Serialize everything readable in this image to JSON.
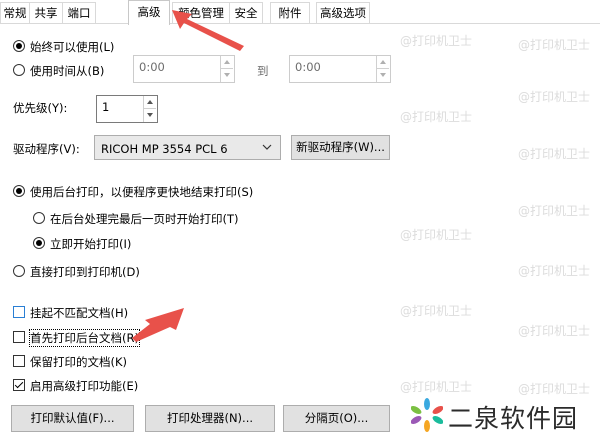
{
  "tabs": [
    "常规",
    "共享",
    "端口",
    "高级",
    "颜色管理",
    "安全",
    "附件",
    "高级选项"
  ],
  "active_tab": "高级",
  "availability": {
    "always_label": "始终可以使用(L)",
    "from_label": "使用时间从(B)",
    "start_time": "0:00",
    "to_label": "到",
    "end_time": "0:00"
  },
  "priority": {
    "label": "优先级(Y):",
    "value": "1"
  },
  "driver": {
    "label": "驱动程序(V):",
    "selected": "RICOH MP 3554 PCL 6",
    "new_button": "新驱动程序(W)..."
  },
  "spool": {
    "spool_label": "使用后台打印，以便程序更快地结束打印(S)",
    "after_last_page_label": "在后台处理完最后一页时开始打印(T)",
    "immediately_label": "立即开始打印(I)",
    "direct_label": "直接打印到打印机(D)"
  },
  "options": {
    "hold_mismatched": "挂起不匹配文档(H)",
    "print_spooled_first": "首先打印后台文档(R)",
    "keep_printed": "保留打印的文档(K)",
    "enable_advanced": "启用高级打印功能(E)"
  },
  "buttons": {
    "defaults": "打印默认值(F)...",
    "processor": "打印处理器(N)...",
    "separator": "分隔页(O)..."
  },
  "watermark": {
    "text": "@打印机卫士",
    "brand": "二泉软件园"
  },
  "colors": {
    "arrow": "#e8514a",
    "focus": "#2a7fd4"
  }
}
